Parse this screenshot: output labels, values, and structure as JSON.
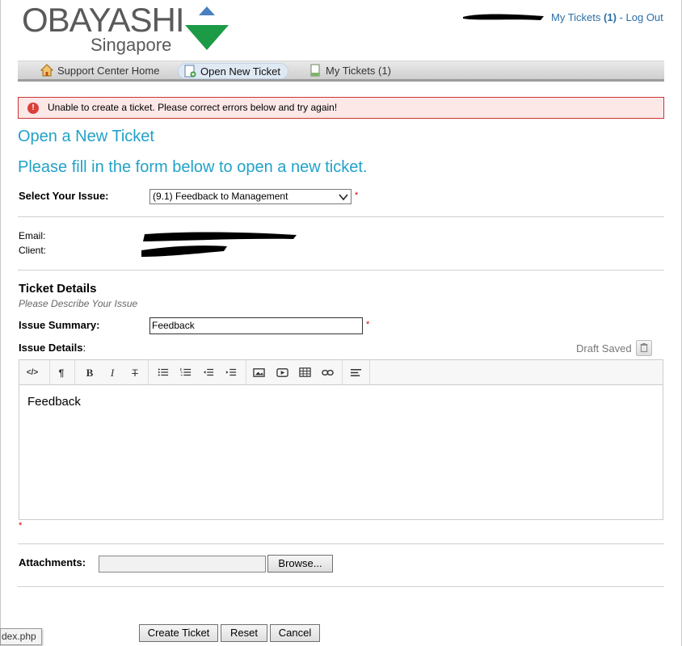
{
  "logo": {
    "name": "OBAYASHI",
    "sub": "Singapore",
    "colors": {
      "top": "#4a7fc0",
      "bottom": "#1d9a46"
    }
  },
  "header": {
    "my_tickets_text": "My Tickets",
    "my_tickets_count": "(1)",
    "separator": "-",
    "logout": "Log Out"
  },
  "nav": {
    "home": {
      "label": "Support Center Home",
      "icon": "home-icon"
    },
    "open": {
      "label": "Open New Ticket",
      "icon": "new-ticket-icon"
    },
    "my": {
      "label": "My Tickets (1)",
      "icon": "document-icon"
    }
  },
  "error": {
    "message": "Unable to create a ticket. Please correct errors below and try again!",
    "icon": "!"
  },
  "page": {
    "title": "Open a New Ticket",
    "intro": "Please fill in the form below to open a new ticket."
  },
  "form": {
    "issue_label": "Select Your Issue:",
    "issue_value": "(9.1) Feedback to Management",
    "required_mark": "*",
    "email_label": "Email:",
    "client_label": "Client:",
    "details_title": "Ticket Details",
    "details_sub": "Please Describe Your Issue",
    "summary_label": "Issue Summary:",
    "summary_value": "Feedback",
    "details_label_bold": "Issue Details",
    "details_label_colon": ":",
    "draft_status": "Draft Saved",
    "editor_content": "Feedback",
    "attachments_label": "Attachments:",
    "browse": "Browse...",
    "create": "Create Ticket",
    "reset": "Reset",
    "cancel": "Cancel"
  },
  "toolbar": {
    "html": "</>",
    "paragraph": "¶",
    "bold": "B",
    "italic": "I",
    "strike": "T"
  },
  "status_bar": {
    "text": "dex.php"
  },
  "colors": {
    "accent": "#21a2c7",
    "link": "#2a6ea6",
    "error_bg": "#fde8e8",
    "error_border": "#cc3333"
  }
}
